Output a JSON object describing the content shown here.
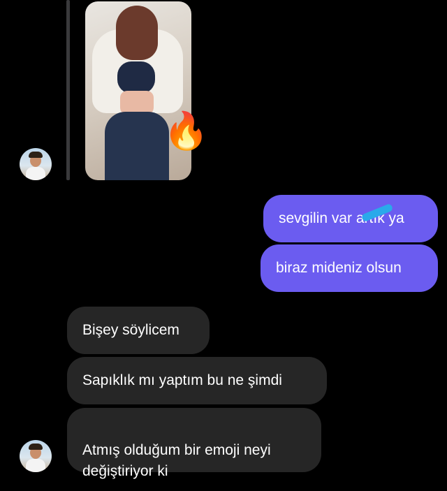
{
  "chat": {
    "shared_media": {
      "reaction_emoji": "🔥"
    },
    "messages_outgoing": [
      {
        "text": "sevgilin var artık ya"
      },
      {
        "text": "biraz mideniz olsun"
      }
    ],
    "messages_incoming": [
      {
        "text": "Bişey söylicem"
      },
      {
        "text": "Sapıklık mı yaptım bu ne şimdi"
      },
      {
        "text": "Atmış olduğum bir emoji neyi\ndeğiştiriyor ki"
      }
    ]
  }
}
